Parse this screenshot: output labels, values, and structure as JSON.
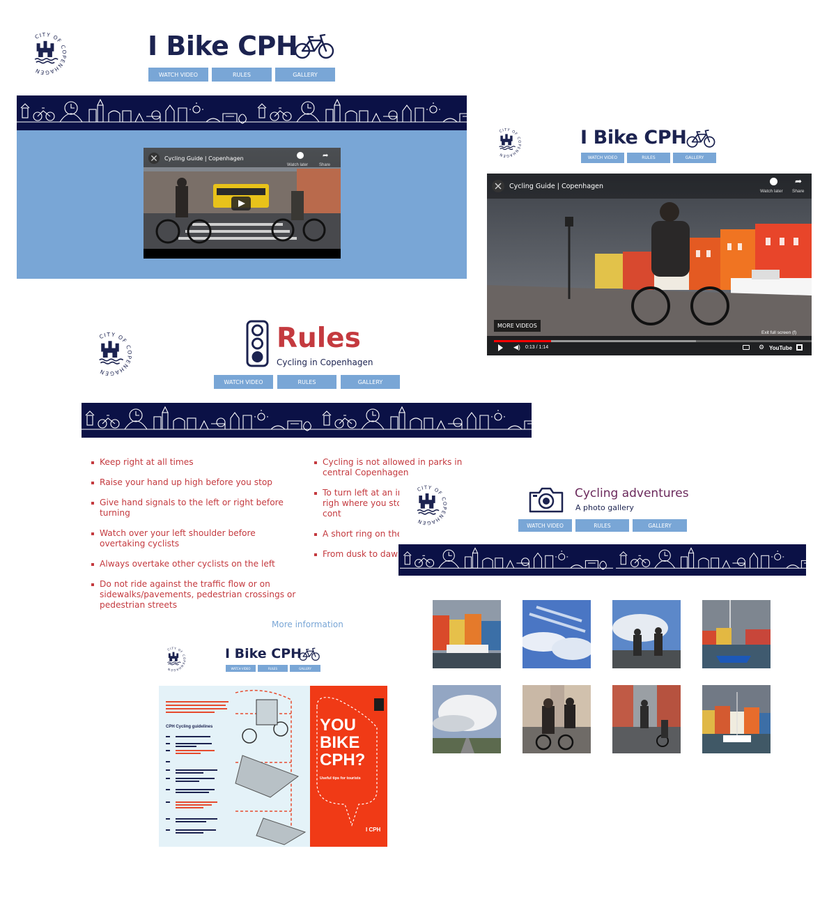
{
  "nav": {
    "watch": "WATCH VIDEO",
    "rules": "RULES",
    "gallery": "GALLERY"
  },
  "brand": {
    "title": "I Bike CPH",
    "logo_text": "CITY OF COPENHAGEN"
  },
  "video": {
    "title": "Cycling Guide | Copenhagen",
    "watch_later": "Watch later",
    "share": "Share",
    "more_videos": "MORE VIDEOS",
    "exit_fullscreen": "Exit full screen (f)",
    "time": "0:13 / 1:14",
    "youtube": "YouTube",
    "progress": 0.18
  },
  "rules_page": {
    "title": "Rules",
    "subtitle": "Cycling in Copenhagen",
    "left_rules": [
      "Keep right at all times",
      "Raise your hand up high before you stop",
      "Give hand signals to the left or right before turning",
      "Watch over your left shoulder before overtaking cyclists",
      "Always overtake other cyclists on the left",
      "Do not ride against the traffic flow or on sidewalks/pavements, pedestrian crossings or pedestrian streets"
    ],
    "right_rules": [
      "Cycling is not allowed in parks in central Copenhagen",
      "To turn left at an int to the opposite righ where you stop and change before cont",
      "A short ring on the cyclist wants to pas",
      "From dusk to dawn with bicycle lights f"
    ],
    "more_info": "More information"
  },
  "gallery_page": {
    "title": "Cycling adventures",
    "subtitle": "A photo gallery"
  },
  "brochure": {
    "heading": "CPH Cycling guidelines",
    "cover_title": "YOU BIKE CPH?",
    "cover_sub": "Useful tips for tourists",
    "cover_logo": "I CPH"
  },
  "colors": {
    "navy": "#0b1146",
    "nav_blue": "#79a6d6",
    "rules_red": "#c43a3f",
    "video_panel": "#79a6d6",
    "gallery_purple": "#6b2a5c",
    "cover_red": "#f03a16"
  }
}
